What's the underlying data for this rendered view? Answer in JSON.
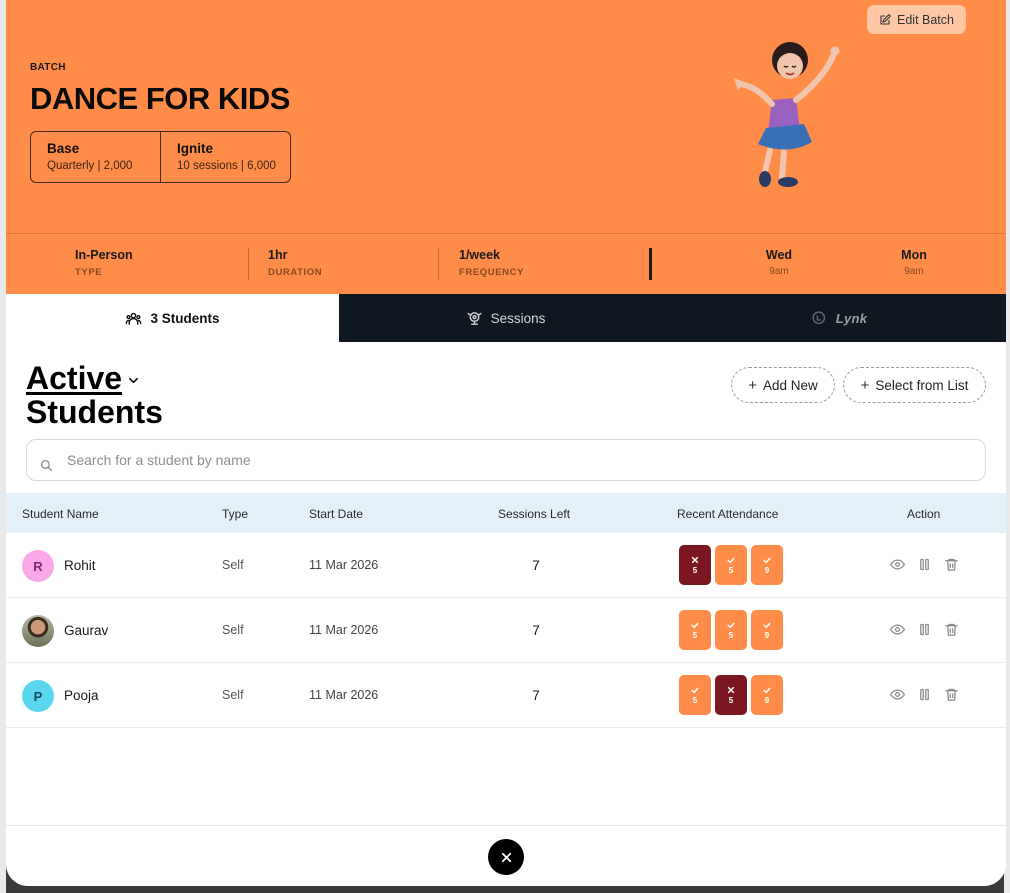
{
  "header": {
    "edit_label": "Edit Batch",
    "batch_label": "BATCH",
    "title": "DANCE FOR KIDS",
    "plans": [
      {
        "name": "Base",
        "detail": "Quarterly | 2,000"
      },
      {
        "name": "Ignite",
        "detail": "10 sessions | 6,000"
      }
    ],
    "info": [
      {
        "value": "In-Person",
        "label": "TYPE"
      },
      {
        "value": "1hr",
        "label": "DURATION"
      },
      {
        "value": "1/week",
        "label": "FREQUENCY"
      }
    ],
    "schedule": [
      {
        "day": "Wed",
        "time": "9am"
      },
      {
        "day": "Mon",
        "time": "9am"
      }
    ]
  },
  "tabs": [
    {
      "label": "3 Students"
    },
    {
      "label": "Sessions"
    },
    {
      "label": "Lynk"
    }
  ],
  "section": {
    "status": "Active",
    "subtitle": "Students",
    "add_new": "Add New",
    "select_list": "Select from List"
  },
  "search": {
    "placeholder": "Search for a student by name",
    "value": ""
  },
  "table": {
    "headers": [
      "Student Name",
      "Type",
      "Start Date",
      "Sessions Left",
      "Recent Attendance",
      "Action"
    ],
    "rows": [
      {
        "initial": "R",
        "name": "Rohit",
        "type": "Self",
        "start": "11 Mar 2026",
        "left": "7",
        "attendance": [
          {
            "status": "absent",
            "num": "5"
          },
          {
            "status": "present",
            "num": "5"
          },
          {
            "status": "present",
            "num": "9"
          }
        ]
      },
      {
        "initial": "",
        "name": "Gaurav",
        "type": "Self",
        "start": "11 Mar 2026",
        "left": "7",
        "attendance": [
          {
            "status": "present",
            "num": "5"
          },
          {
            "status": "present",
            "num": "5"
          },
          {
            "status": "present",
            "num": "9"
          }
        ]
      },
      {
        "initial": "P",
        "name": "Pooja",
        "type": "Self",
        "start": "11 Mar 2026",
        "left": "7",
        "attendance": [
          {
            "status": "present",
            "num": "5"
          },
          {
            "status": "absent",
            "num": "5"
          },
          {
            "status": "present",
            "num": "9"
          }
        ]
      }
    ]
  },
  "colors": {
    "brand_orange": "#ff8c48",
    "absent_red": "#7a1720",
    "dark_tabs": "#0f1720",
    "table_header": "#e4f0f8"
  },
  "icons": {
    "edit": "edit-icon",
    "students": "group-icon",
    "sessions": "webcam-icon",
    "lynk": "lynk-logo-icon",
    "search": "search-icon",
    "view": "eye-icon",
    "pause": "pause-icon",
    "delete": "trash-icon",
    "close": "close-icon"
  }
}
